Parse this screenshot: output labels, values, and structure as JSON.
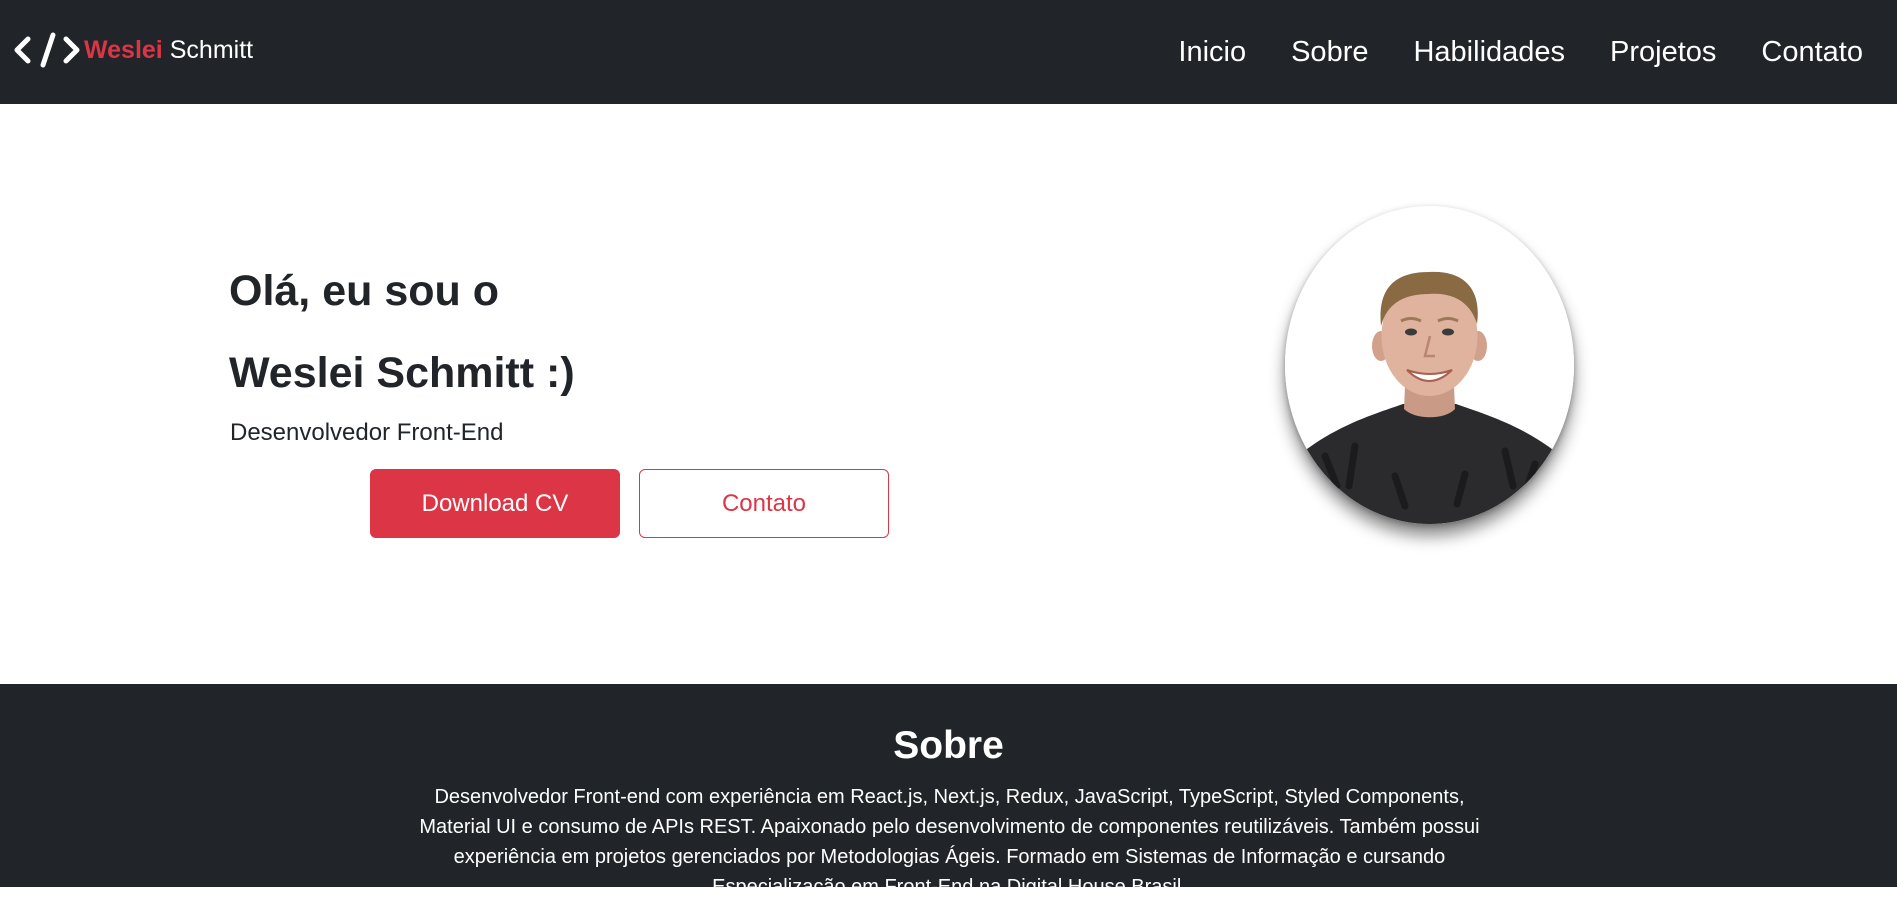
{
  "navbar": {
    "brand_icon": "code-brackets-icon",
    "brand_first": "Weslei",
    "brand_last": "Schmitt",
    "links": [
      "Inicio",
      "Sobre",
      "Habilidades",
      "Projetos",
      "Contato"
    ]
  },
  "hero": {
    "title_line1": "Olá, eu sou o",
    "title_line2": "Weslei Schmitt :)",
    "subtitle": "Desenvolvedor Front-End",
    "download_button": "Download CV",
    "contact_button": "Contato",
    "avatar_icon": "profile-photo"
  },
  "about": {
    "title": "Sobre",
    "text": "Desenvolvedor Front-end com experiência em React.js, Next.js, Redux, JavaScript, TypeScript, Styled Components, Material UI e consumo de APIs REST. Apaixonado pelo desenvolvimento de componentes reutilizáveis. Também possui experiência em projetos gerenciados por Metodologias Ágeis. Formado em Sistemas de Informação e cursando Especialização em Front-End na Digital House Brasil."
  },
  "colors": {
    "dark": "#212529",
    "accent": "#dc3545",
    "white": "#ffffff"
  }
}
